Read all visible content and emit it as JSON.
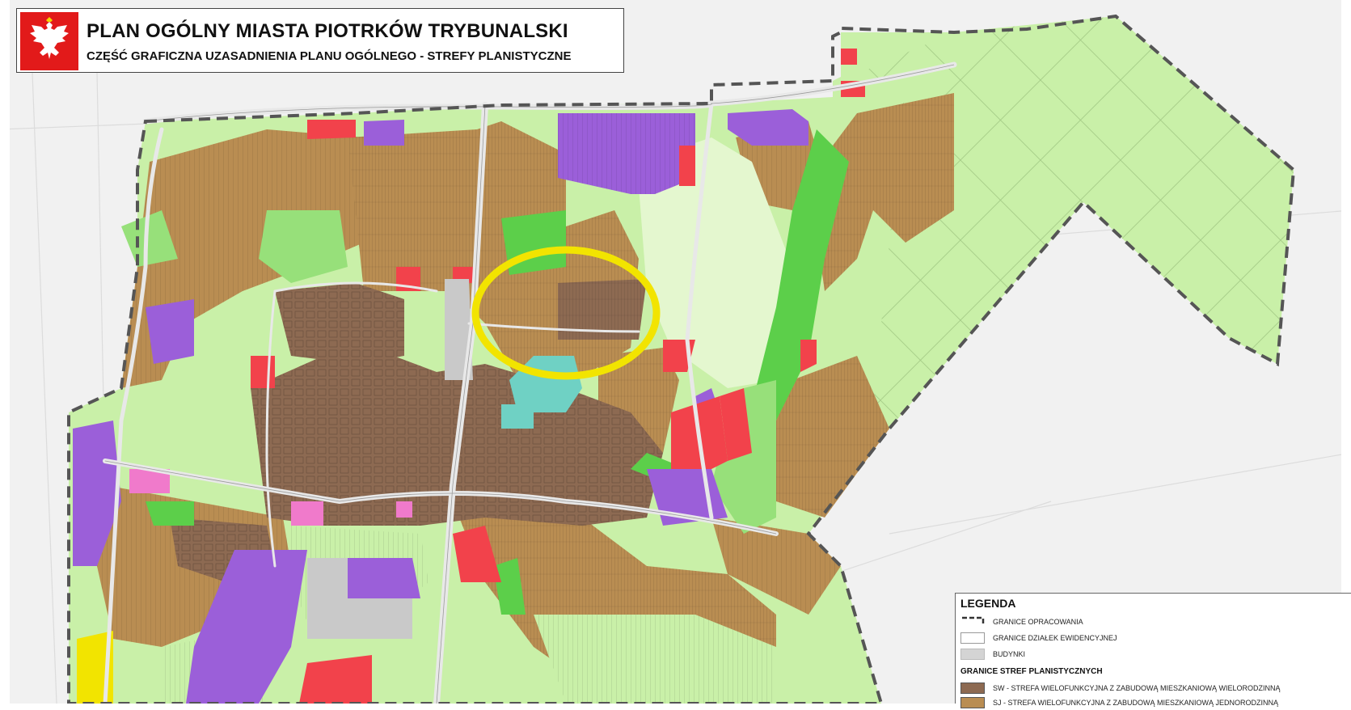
{
  "header": {
    "title": "PLAN OGÓLNY MIASTA PIOTRKÓW TRYBUNALSKI",
    "subtitle": "CZĘŚĆ GRAFICZNA UZASADNIENIA PLANU OGÓLNEGO - STREFY PLANISTYCZNE",
    "emblem_icon": "white-eagle-coat-of-arms-icon"
  },
  "legend": {
    "title": "LEGENDA",
    "items": [
      {
        "label": "GRANICE OPRACOWANIA",
        "icon": "dashed-boundary-icon"
      },
      {
        "label": "GRANICE DZIAŁEK EWIDENCYJNEJ",
        "icon": "parcel-outline-icon"
      },
      {
        "label": "BUDYNKI",
        "icon": "building-swatch-icon"
      }
    ],
    "zones_title": "GRANICE STREF PLANISTYCZNYCH",
    "zones": [
      {
        "label": "SW - STREFA WIELOFUNKCYJNA Z ZABUDOWĄ MIESZKANIOWĄ WIELORODZINNĄ",
        "color": "#8d6a52"
      },
      {
        "label": "SJ - STREFA WIELOFUNKCYJNA Z ZABUDOWĄ MIESZKANIOWĄ JEDNORODZINNĄ",
        "color": "#b98d52"
      }
    ]
  },
  "colors": {
    "sw_dark_brown": "#8d6a52",
    "sj_brown": "#b98d52",
    "green_light": "#c9f0a8",
    "green_mid": "#97e07a",
    "green_bright": "#5ccf4a",
    "purple": "#9b5fd9",
    "red": "#f2424b",
    "pink": "#f07acb",
    "teal": "#6fd1c4",
    "grey_building": "#c9c9c9",
    "yellow_highlight": "#f2e400",
    "boundary_dash": "#555555"
  },
  "annotation": {
    "highlight_shape": "yellow-ellipse",
    "highlight_color": "#f2e400"
  }
}
